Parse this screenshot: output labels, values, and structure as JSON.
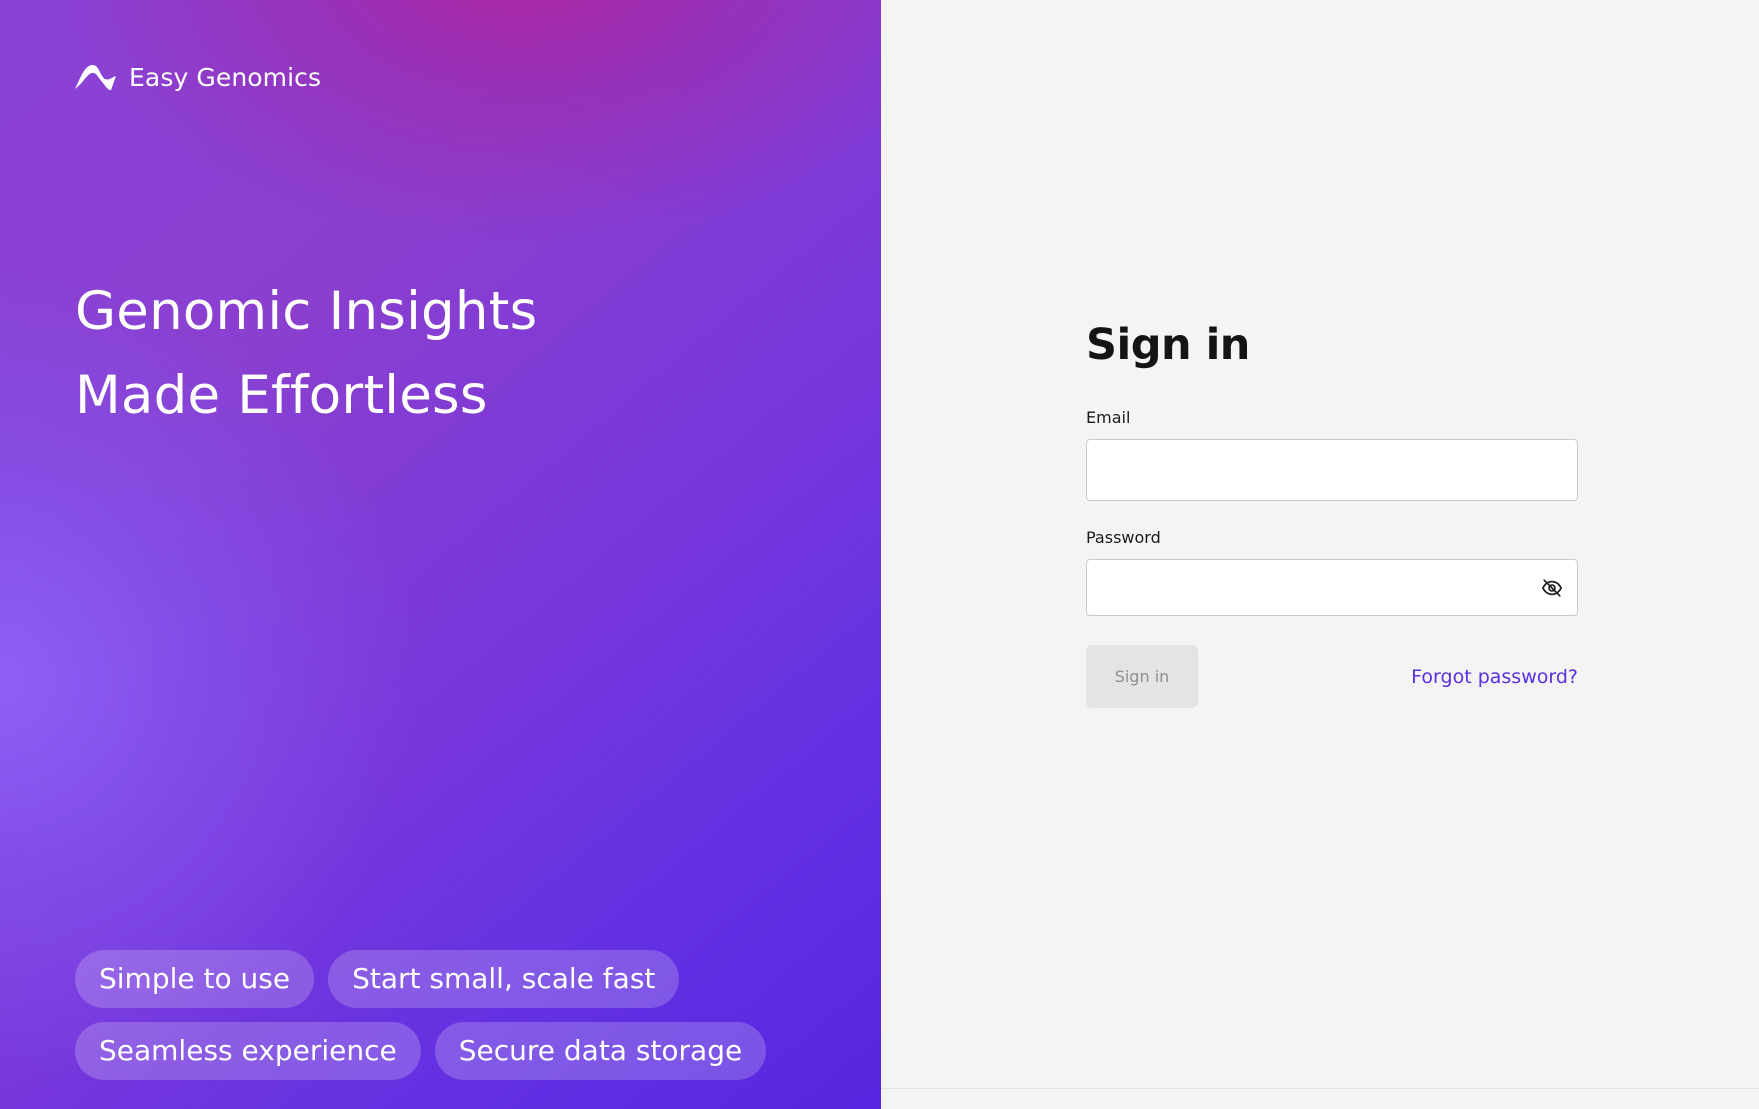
{
  "brand": {
    "name": "Easy Genomics",
    "icon": "wave-logo-icon"
  },
  "hero": {
    "headline_line1": "Genomic Insights",
    "headline_line2": "Made Effortless",
    "features": [
      "Simple to use",
      "Start small, scale fast",
      "Seamless experience",
      "Secure data storage"
    ]
  },
  "signin": {
    "title": "Sign in",
    "email_label": "Email",
    "email_value": "",
    "password_label": "Password",
    "password_value": "",
    "password_toggle_icon": "eye-off-icon",
    "submit_label": "Sign in",
    "forgot_label": "Forgot password?"
  },
  "colors": {
    "accent": "#5b2ee0",
    "hero_gradient_start": "#8a42d6",
    "hero_gradient_end": "#5626e0",
    "hero_highlight": "#b226a0",
    "panel_background": "#f4f4f4",
    "button_disabled_bg": "#e4e4e4",
    "button_disabled_text": "#8f8f8f"
  }
}
